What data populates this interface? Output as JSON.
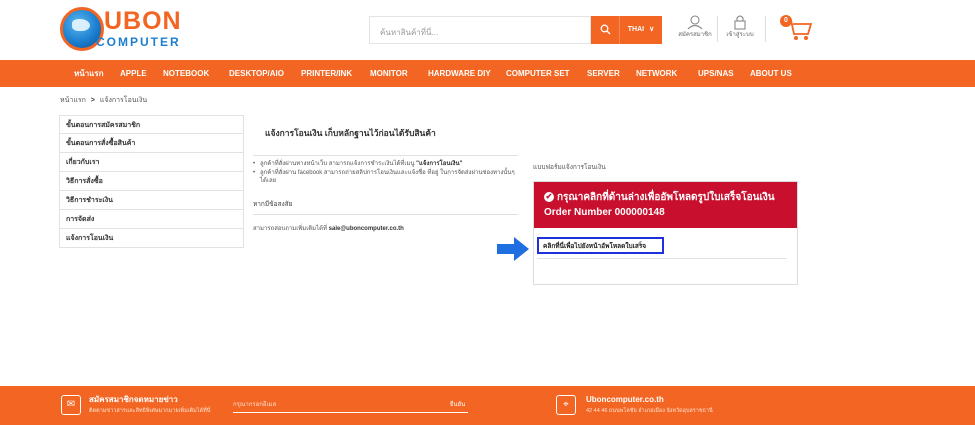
{
  "header": {
    "logo_ubon": "UBON",
    "logo_computer": "COMPUTER",
    "search_placeholder": "ค้นหาสินค้าที่นี่...",
    "search_icon": "magnifier-icon",
    "lang": "THAI",
    "lang_caret": "∨",
    "register_label": "สมัครสมาชิก",
    "login_label": "เข้าสู่ระบบ",
    "cart_count": "0"
  },
  "nav": {
    "items": [
      "หน้าแรก",
      "APPLE",
      "NOTEBOOK",
      "DESKTOP/AIO",
      "PRINTER/INK",
      "MONITOR",
      "HARDWARE DIY",
      "COMPUTER SET",
      "SERVER",
      "NETWORK",
      "UPS/NAS",
      "ABOUT US"
    ]
  },
  "breadcrumb": {
    "home": "หน้าแรก",
    "sep": ">",
    "current": "แจ้งการโอนเงิน"
  },
  "sidebar": {
    "items": [
      "ขั้นตอนการสมัครสมาชิก",
      "ขั้นตอนการสั่งซื้อสินค้า",
      "เกี่ยวกับเรา",
      "วิธีการสั่งซื้อ",
      "วิธีการชำระเงิน",
      "การจัดส่ง",
      "แจ้งการโอนเงิน"
    ]
  },
  "main": {
    "title": "แจ้งการโอนเงิน เก็บหลักฐานไว้ก่อนได้รับสินค้า",
    "bullet1_text": "ลูกค้าที่สั่งผ่านทางหน้าเว็บ สามารถแจ้งการชำระเงินได้ที่เมนู ",
    "bullet1_bold": "\"แจ้งการโอนเงิน\"",
    "bullet2_text": "ลูกค้าที่สั่งผ่าน facebook สามารถถ่ายสลิปการโอนเงินและแจ้งชื่อ ที่อยู่ ในการจัดส่งผ่านช่องทางนั้นๆได้เลย",
    "subhead": "หากมีข้อสงสัย",
    "contact_text": "สามารถสอบถามเพิ่มเติมได้ที่ ",
    "contact_email": "sale@uboncomputer.co.th"
  },
  "form": {
    "label": "แบบฟอร์มแจ้งการโอนเงิน",
    "banner_text": "กรุณาคลิกที่ด้านล่างเพื่ออัพโหลดรูปใบเสร็จโอนเงิน Order Number 000000148",
    "upload_link": "คลิกที่นี่เพื่อไปยังหน้าอัพโหลดใบเสร็จ"
  },
  "footer": {
    "newsletter_title": "สมัครสมาชิกจดหมายข่าว",
    "newsletter_sub": "ติดตามข่าวสารและสิทธิพิเศษมากมายเพิ่มเติมได้ที่นี่",
    "email_placeholder": "กรุณากรอกอีเมล",
    "submit_label": "ยืนยัน",
    "site_title": "Uboncomputer.co.th",
    "address": "42 44 46 ถนนพโลชัย อำเภอเมือง จังหวัดอุบลราชธานี"
  },
  "colors": {
    "brand_orange": "#f26522",
    "banner_red": "#c8102e",
    "highlight_blue": "#1f2fdc"
  }
}
